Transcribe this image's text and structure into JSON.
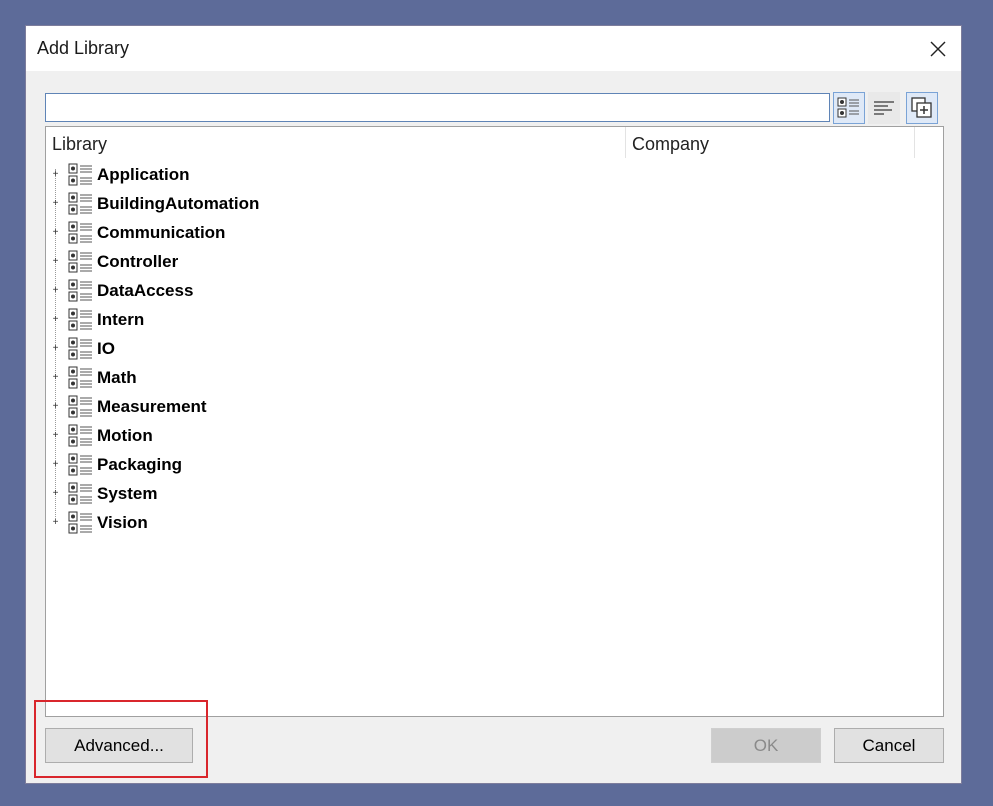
{
  "dialog": {
    "title": "Add Library"
  },
  "search": {
    "value": "",
    "placeholder": ""
  },
  "toolbar": {
    "tree_view_icon": "category-tree-icon",
    "list_view_icon": "list-view-icon",
    "add_icon": "add-copy-icon"
  },
  "table": {
    "columns": [
      "Library",
      "Company"
    ]
  },
  "tree": {
    "items": [
      "Application",
      "BuildingAutomation",
      "Communication",
      "Controller",
      "DataAccess",
      "Intern",
      "IO",
      "Math",
      "Measurement",
      "Motion",
      "Packaging",
      "System",
      "Vision"
    ],
    "expander_glyph": "+"
  },
  "buttons": {
    "advanced": "Advanced...",
    "ok": "OK",
    "cancel": "Cancel"
  },
  "colors": {
    "highlight": "#d9262c",
    "selection_border": "#5f84b6",
    "background": "#5d6b99"
  }
}
